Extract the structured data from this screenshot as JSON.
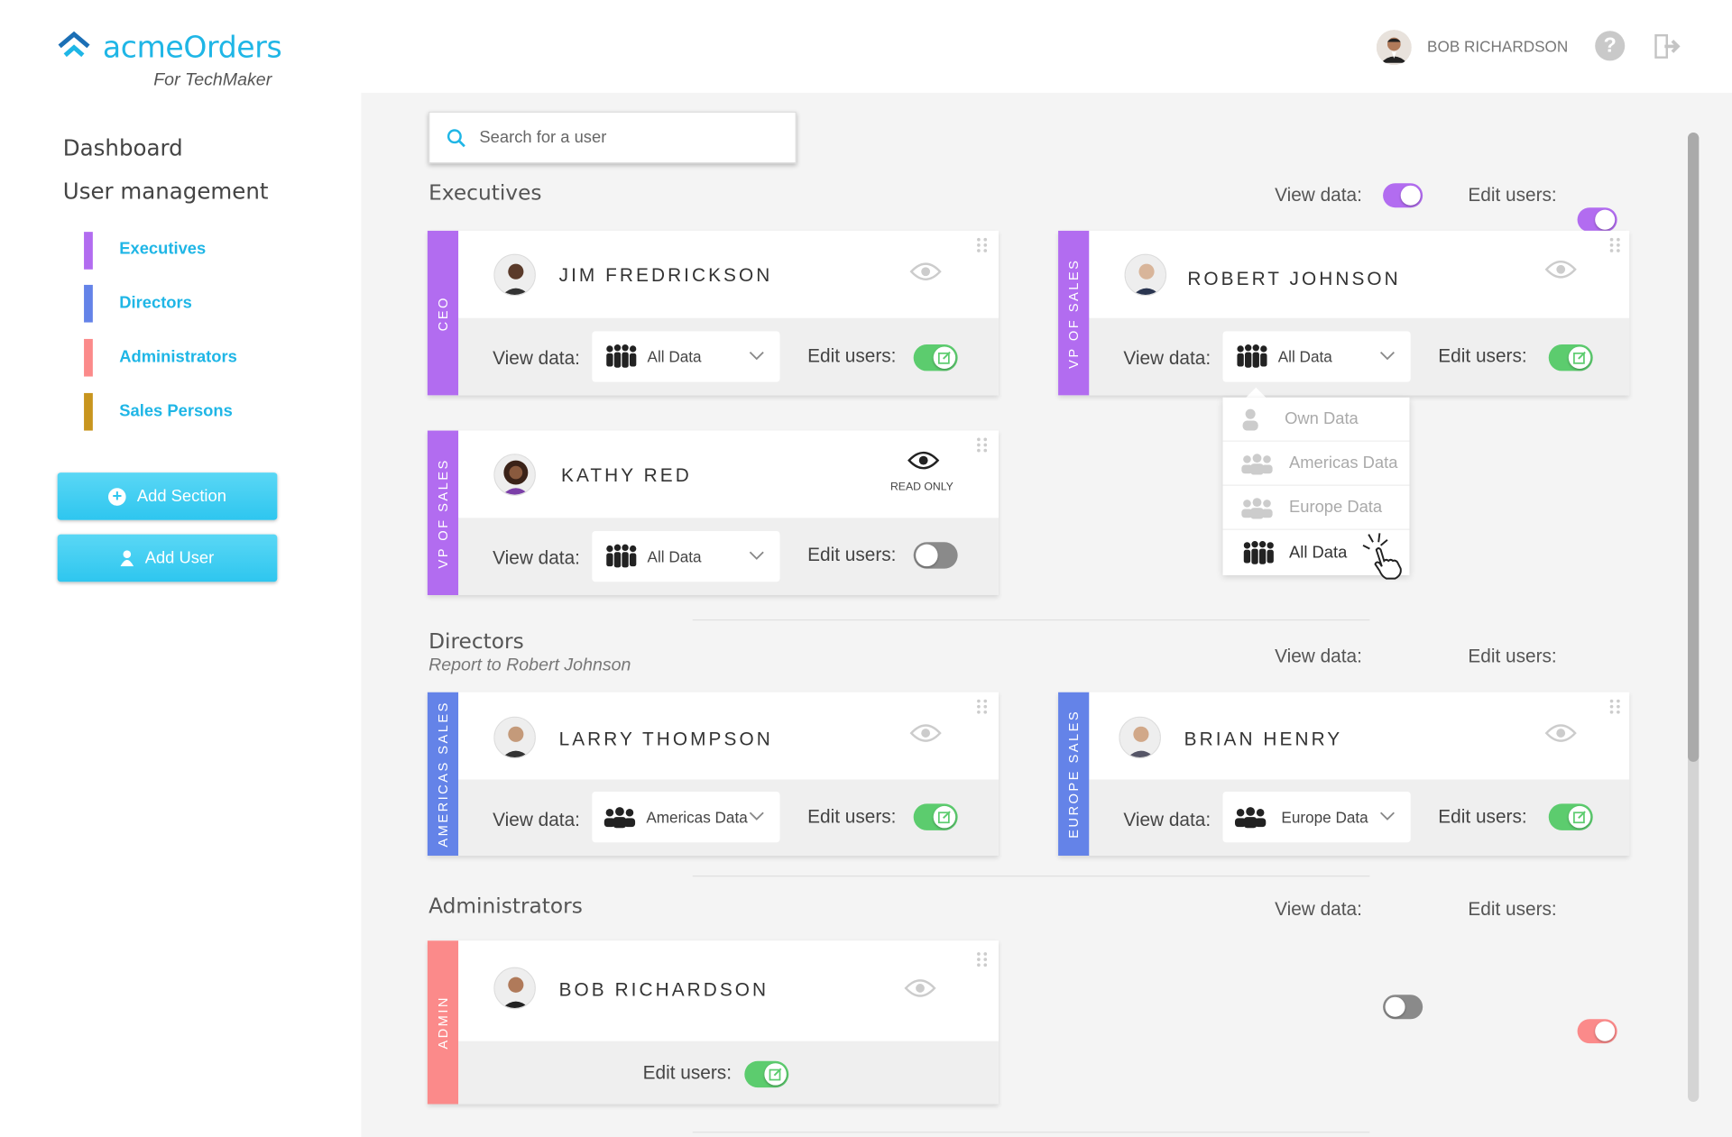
{
  "app": {
    "name": "acmeOrders",
    "tenant": "For TechMaker"
  },
  "header": {
    "user_name": "BOB RICHARDSON",
    "help_icon": "question-circle-icon",
    "logout_icon": "logout-icon"
  },
  "sidebar": {
    "nav": [
      "Dashboard",
      "User management"
    ],
    "sections": [
      {
        "label": "Executives",
        "color": "#b26cf0"
      },
      {
        "label": "Directors",
        "color": "#6483e8"
      },
      {
        "label": "Administrators",
        "color": "#fb8a8a"
      },
      {
        "label": "Sales Persons",
        "color": "#c8951e"
      }
    ],
    "buttons": {
      "add_section": "Add Section",
      "add_user": "Add User"
    }
  },
  "search": {
    "placeholder": "Search for a user"
  },
  "labels": {
    "view_data": "View data:",
    "edit_users": "Edit users:",
    "read_only": "READ ONLY"
  },
  "sections": {
    "executives": {
      "title": "Executives",
      "color": "#b26cf0",
      "view_data": true,
      "edit_users": true,
      "users": [
        {
          "name": "JIM FREDRICKSON",
          "role": "CEO",
          "view_data": "All Data",
          "edit_users": true,
          "read_only": false
        },
        {
          "name": "ROBERT JOHNSON",
          "role": "VP OF SALES",
          "view_data": "All Data",
          "edit_users": true,
          "read_only": false
        },
        {
          "name": "KATHY RED",
          "role": "VP OF SALES",
          "view_data": "All Data",
          "edit_users": false,
          "read_only": true
        }
      ]
    },
    "directors": {
      "title": "Directors",
      "subtitle": "Report to Robert Johnson",
      "color": "#6483e8",
      "view_data": true,
      "edit_users": true,
      "users": [
        {
          "name": "LARRY THOMPSON",
          "role": "AMERICAS SALES",
          "view_data": "Americas Data",
          "edit_users": true,
          "read_only": false
        },
        {
          "name": "BRIAN HENRY",
          "role": "EUROPE SALES",
          "view_data": "Europe Data",
          "edit_users": true,
          "read_only": false
        }
      ]
    },
    "administrators": {
      "title": "Administrators",
      "color": "#fb8a8a",
      "view_data": false,
      "edit_users": true,
      "users": [
        {
          "name": "BOB RICHARDSON",
          "role": "ADMIN",
          "edit_users": true,
          "read_only": false
        }
      ]
    }
  },
  "view_data_menu": {
    "open_for": "ROBERT JOHNSON",
    "options": [
      "Own Data",
      "Americas Data",
      "Europe Data",
      "All Data"
    ],
    "selected": "All Data"
  },
  "colors": {
    "accent": "#1fb6e6",
    "toggle_on": "#5ccc6e",
    "toggle_off": "#8a8a8a"
  }
}
